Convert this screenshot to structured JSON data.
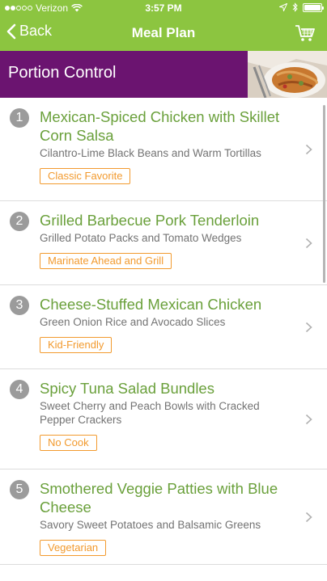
{
  "status_bar": {
    "carrier": "Verizon",
    "time": "3:57 PM",
    "battery_level": 1.0
  },
  "nav": {
    "back_label": "Back",
    "title": "Meal Plan",
    "cart_icon": "shopping-cart-icon"
  },
  "banner": {
    "title": "Portion Control"
  },
  "colors": {
    "nav_green": "#8cc540",
    "banner_purple": "#6b1470",
    "title_green": "#6aa03b",
    "tag_orange": "#f29a2e"
  },
  "meals": [
    {
      "number": "1",
      "title": "Mexican-Spiced Chicken with Skillet Corn Salsa",
      "sides": "Cilantro-Lime Black Beans and Warm Tortillas",
      "tag": "Classic Favorite"
    },
    {
      "number": "2",
      "title": "Grilled Barbecue Pork Tenderloin",
      "sides": "Grilled Potato Packs and Tomato Wedges",
      "tag": "Marinate Ahead and Grill"
    },
    {
      "number": "3",
      "title": "Cheese-Stuffed Mexican Chicken",
      "sides": "Green Onion Rice and Avocado Slices",
      "tag": "Kid-Friendly"
    },
    {
      "number": "4",
      "title": "Spicy Tuna Salad Bundles",
      "sides": "Sweet Cherry and Peach Bowls with Cracked Pepper Crackers",
      "tag": "No Cook"
    },
    {
      "number": "5",
      "title": "Smothered Veggie Patties with Blue Cheese",
      "sides": "Savory Sweet Potatoes and Balsamic Greens",
      "tag": "Vegetarian"
    }
  ]
}
